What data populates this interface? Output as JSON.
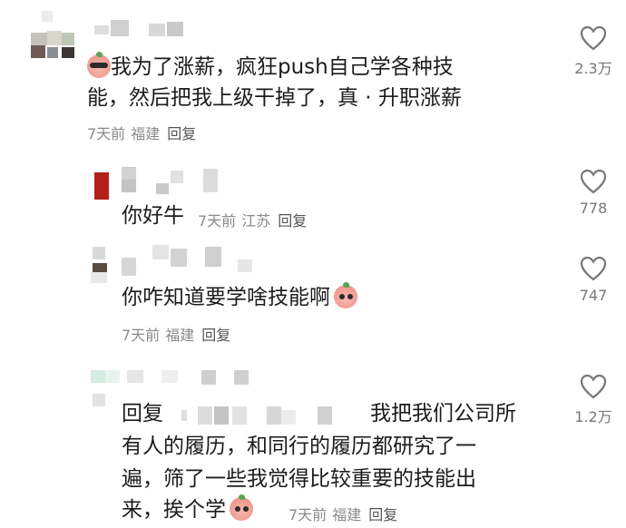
{
  "comments": [
    {
      "text": "我为了涨薪，疯狂push自己学各种技能，然后把我上级干掉了，真 · 升职涨薪",
      "line1": "我为了涨薪，疯狂push自己学各种技",
      "line2": "能，然后把我上级干掉了，真 · 升职涨薪",
      "time": "7天前",
      "location": "福建",
      "reply_label": "回复",
      "likes": "2.3万"
    },
    {
      "text": "你好牛",
      "time": "7天前",
      "location": "江苏",
      "reply_label": "回复",
      "likes": "778"
    },
    {
      "text": "你咋知道要学啥技能啊",
      "time": "7天前",
      "location": "福建",
      "reply_label": "回复",
      "likes": "747"
    },
    {
      "reply_prefix": "回复",
      "line1": "我把我们公司所",
      "line2": "有人的履历，和同行的履历都研究了一",
      "line3": "遍，筛了一些我觉得比较重要的技能出",
      "line4": "来，挨个学",
      "time": "7天前",
      "location": "福建",
      "reply_label": "回复",
      "likes": "1.2万"
    }
  ],
  "icons": {
    "like": "heart-outline-icon",
    "emoji_cool": "pig-sunglasses-emoji",
    "emoji_sad": "pig-sad-emoji"
  },
  "colors": {
    "text": "#1c1c1c",
    "meta": "#8a8a8a",
    "icon": "#777777"
  }
}
